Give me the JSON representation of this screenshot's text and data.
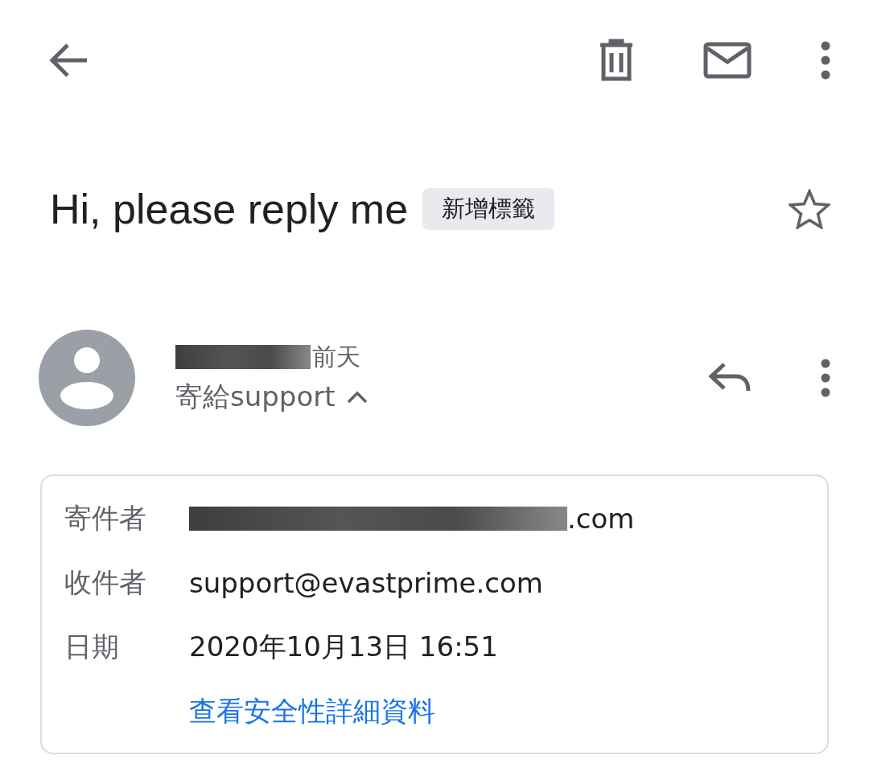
{
  "subject": "Hi, please reply me",
  "label_chip": "新增標籤",
  "starred": false,
  "sender": {
    "name_redacted": true,
    "time": "前天",
    "recipient_line": "寄給support",
    "details_expanded": true
  },
  "details": [
    {
      "label": "寄件者",
      "value": ".com",
      "redacted": true
    },
    {
      "label": "收件者",
      "value": "support@evastprime.com",
      "redacted": false
    },
    {
      "label": "日期",
      "value": "2020年10月13日 16:51",
      "redacted": false
    }
  ],
  "security_link": "查看安全性詳細資料"
}
